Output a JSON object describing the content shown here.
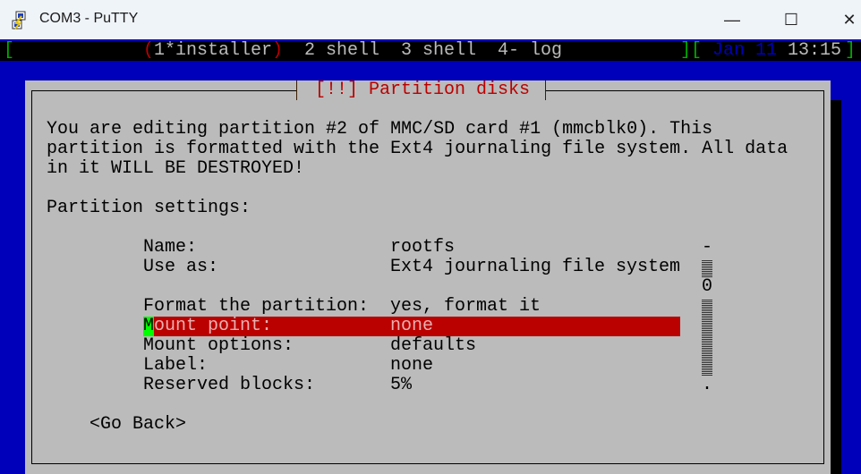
{
  "window": {
    "title": "COM3 - PuTTY",
    "buttons": {
      "minimize": "—",
      "maximize": "☐",
      "close": "✕"
    }
  },
  "status_bar": {
    "open_bracket": "[",
    "active_window": "1*installer",
    "active_paren_open": "(",
    "active_paren_close": ")",
    "windows": [
      "2 shell",
      "3 shell",
      "4- log"
    ],
    "mid_brackets": "][",
    "date": "Jan 11",
    "time": "13:15",
    "close_bracket": "]"
  },
  "dialog": {
    "title": "[!!] Partition disks",
    "message": [
      "You are editing partition #2 of MMC/SD card #1 (mmcblk0). This",
      "partition is formatted with the Ext4 journaling file system. All data",
      "in it WILL BE DESTROYED!"
    ],
    "section_label": "Partition settings:",
    "settings": [
      {
        "label": "Name:",
        "value": "rootfs"
      },
      {
        "label": "Use as:",
        "value": "Ext4 journaling file system"
      },
      {
        "label": "Format the partition:",
        "value": "yes, format it"
      },
      {
        "label_first": "M",
        "label": "ount point:",
        "value": "none",
        "selected": true
      },
      {
        "label": "Mount options:",
        "value": "defaults"
      },
      {
        "label": "Label:",
        "value": "none"
      },
      {
        "label": "Reserved blocks:",
        "value": "5%"
      }
    ],
    "scrollbar": {
      "top": "-",
      "thumb": "0",
      "bottom": "."
    },
    "go_back": "<Go Back>"
  },
  "colors": {
    "background": "#0000bb",
    "dialog": "#bbbbbb",
    "highlight": "#bb0000",
    "cursor": "#00ff00",
    "title_text": "#bb0000"
  }
}
